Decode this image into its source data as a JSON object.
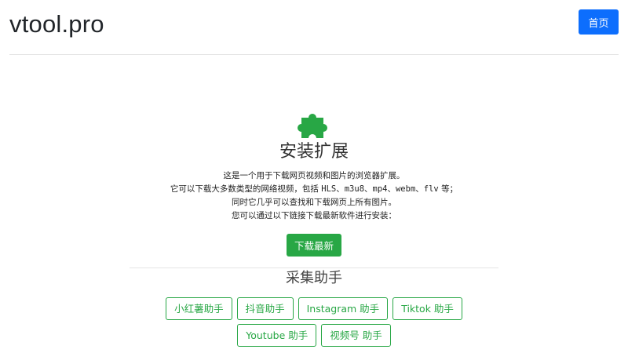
{
  "header": {
    "brand": "vtool.pro",
    "home_label": "首页"
  },
  "hero": {
    "icon": "puzzle-piece-icon",
    "icon_color": "#28a745",
    "title": "安装扩展",
    "desc_line1": "这是一个用于下载网页视频和图片的浏览器扩展。",
    "desc_line2_prefix": "它可以下载大多数类型的网络视频，包括 ",
    "desc_line2_formats": "HLS、m3u8、mp4、webm、flv",
    "desc_line2_suffix": " 等；",
    "desc_line3": "同时它几乎可以查找和下载网页上所有图片。",
    "desc_line4": "您可以通过以下链接下载最新软件进行安装：",
    "download_label": "下载最新"
  },
  "helpers_section": {
    "title": "采集助手",
    "items": [
      {
        "label": "小红薯助手"
      },
      {
        "label": "抖音助手"
      },
      {
        "label": "Instagram 助手"
      },
      {
        "label": "Tiktok 助手"
      },
      {
        "label": "Youtube 助手"
      },
      {
        "label": "视频号 助手"
      }
    ]
  },
  "colors": {
    "primary": "#0d6efd",
    "success": "#28a745"
  }
}
